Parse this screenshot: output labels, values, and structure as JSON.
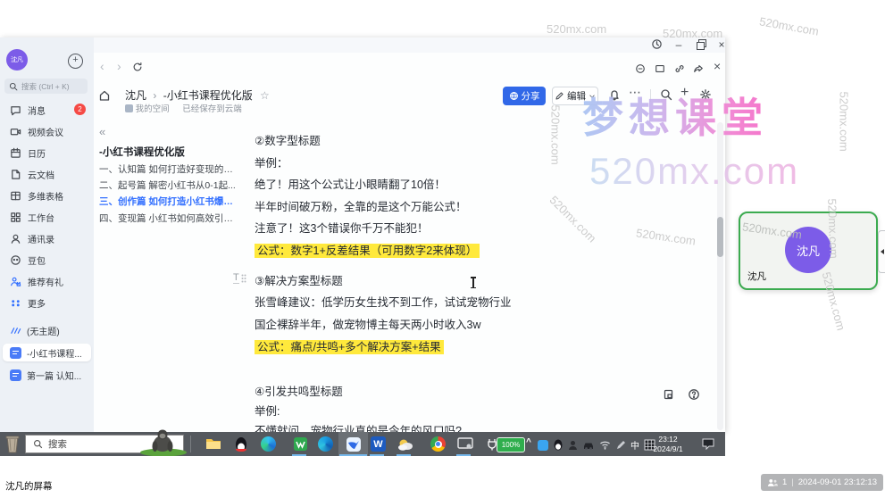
{
  "watermarks": {
    "brand": "梦想课堂",
    "site": "520mx.com",
    "small": "520mx.com"
  },
  "app": {
    "sidebar": {
      "avatar_text": "沈凡",
      "search_placeholder": "搜索 (Ctrl + K)",
      "items": [
        {
          "label": "消息",
          "badge": "2"
        },
        {
          "label": "视频会议"
        },
        {
          "label": "日历"
        },
        {
          "label": "云文档"
        },
        {
          "label": "多维表格"
        },
        {
          "label": "工作台"
        },
        {
          "label": "通讯录"
        },
        {
          "label": "豆包"
        },
        {
          "label": "推荐有礼"
        },
        {
          "label": "更多"
        }
      ],
      "docs": [
        {
          "label": "(无主题)"
        },
        {
          "label": "-小红书课程..."
        },
        {
          "label": "第一篇 认知..."
        }
      ]
    },
    "header": {
      "breadcrumb_user": "沈凡",
      "breadcrumb_sep": "›",
      "breadcrumb_title": "-小红书课程优化版",
      "star": "☆",
      "space": "我的空间",
      "save_status": "已经保存到云端",
      "share_label": "分享",
      "edit_label": "编辑",
      "more_glyph": "⋯",
      "plus_glyph": "+",
      "back_glyph": "‹",
      "forward_glyph": "›",
      "min_glyph": "–",
      "close_glyph": "×"
    },
    "outline": {
      "collapse_glyph": "«",
      "title": "-小红书课程优化版",
      "items": [
        {
          "label": "一、认知篇 如何打造好变现的小..."
        },
        {
          "label": "二、起号篇 解密小红书从0-1起..."
        },
        {
          "label": "三、创作篇 如何打造小红书爆款..."
        },
        {
          "label": "四、变现篇 小红书如何高效引流..."
        }
      ]
    },
    "content": [
      {
        "text": "②数字型标题"
      },
      {
        "text": "举例："
      },
      {
        "text": "绝了！用这个公式让小眼睛翻了10倍！"
      },
      {
        "text": "半年时间破万粉，全靠的是这个万能公式！"
      },
      {
        "text": "注意了！这3个错误你千万不能犯！"
      },
      {
        "text": "公式：数字1+反差结果（可用数字2来体现）",
        "highlight": true
      },
      {
        "text": "③解决方案型标题"
      },
      {
        "text": "张雪峰建议：低学历女生找不到工作，试试宠物行业"
      },
      {
        "text": "国企裸辞半年，做宠物博主每天两小时收入3w"
      },
      {
        "text": "公式：痛点/共鸣+多个解决方案+结果",
        "highlight": true
      },
      {
        "text": "④引发共鸣型标题"
      },
      {
        "text": "举例:"
      },
      {
        "text": "不懂就问，宠物行业真的是今年的风口吗?"
      }
    ],
    "block_handle": "T"
  },
  "camera": {
    "name": "沈凡",
    "avatar_text": "沈凡"
  },
  "taskbar": {
    "search_placeholder": "搜索",
    "battery": "100%",
    "tray_caret": "^",
    "ime": "中",
    "clock_time": "23:12",
    "clock_date": "2024/9/1",
    "word_glyph": "W"
  },
  "meeting": {
    "screen_label": "沈凡的屏幕",
    "viewer_count": "1",
    "pill_sep": "|",
    "timestamp": "2024-09-01 23:12:13"
  }
}
